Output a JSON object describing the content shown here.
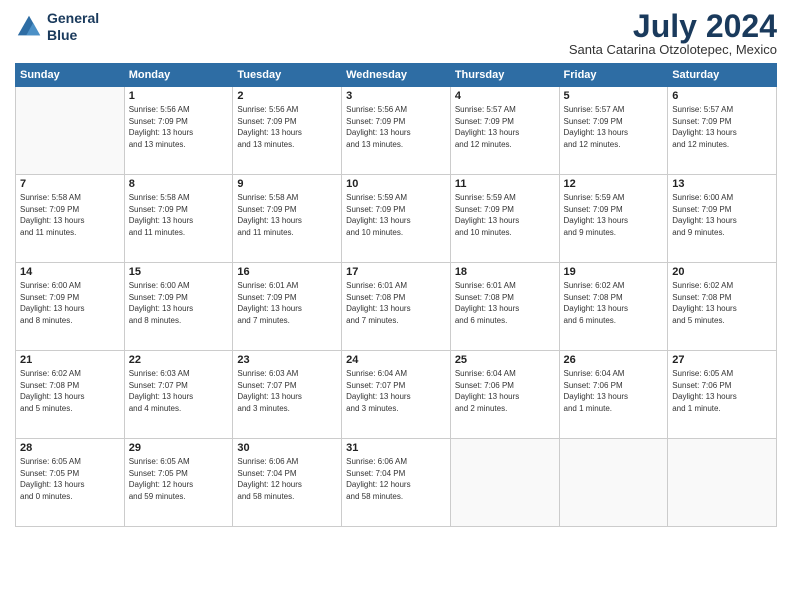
{
  "logo": {
    "line1": "General",
    "line2": "Blue"
  },
  "title": "July 2024",
  "subtitle": "Santa Catarina Otzolotepec, Mexico",
  "days_header": [
    "Sunday",
    "Monday",
    "Tuesday",
    "Wednesday",
    "Thursday",
    "Friday",
    "Saturday"
  ],
  "weeks": [
    [
      {
        "day": "",
        "info": ""
      },
      {
        "day": "1",
        "info": "Sunrise: 5:56 AM\nSunset: 7:09 PM\nDaylight: 13 hours\nand 13 minutes."
      },
      {
        "day": "2",
        "info": "Sunrise: 5:56 AM\nSunset: 7:09 PM\nDaylight: 13 hours\nand 13 minutes."
      },
      {
        "day": "3",
        "info": "Sunrise: 5:56 AM\nSunset: 7:09 PM\nDaylight: 13 hours\nand 13 minutes."
      },
      {
        "day": "4",
        "info": "Sunrise: 5:57 AM\nSunset: 7:09 PM\nDaylight: 13 hours\nand 12 minutes."
      },
      {
        "day": "5",
        "info": "Sunrise: 5:57 AM\nSunset: 7:09 PM\nDaylight: 13 hours\nand 12 minutes."
      },
      {
        "day": "6",
        "info": "Sunrise: 5:57 AM\nSunset: 7:09 PM\nDaylight: 13 hours\nand 12 minutes."
      }
    ],
    [
      {
        "day": "7",
        "info": "Sunrise: 5:58 AM\nSunset: 7:09 PM\nDaylight: 13 hours\nand 11 minutes."
      },
      {
        "day": "8",
        "info": "Sunrise: 5:58 AM\nSunset: 7:09 PM\nDaylight: 13 hours\nand 11 minutes."
      },
      {
        "day": "9",
        "info": "Sunrise: 5:58 AM\nSunset: 7:09 PM\nDaylight: 13 hours\nand 11 minutes."
      },
      {
        "day": "10",
        "info": "Sunrise: 5:59 AM\nSunset: 7:09 PM\nDaylight: 13 hours\nand 10 minutes."
      },
      {
        "day": "11",
        "info": "Sunrise: 5:59 AM\nSunset: 7:09 PM\nDaylight: 13 hours\nand 10 minutes."
      },
      {
        "day": "12",
        "info": "Sunrise: 5:59 AM\nSunset: 7:09 PM\nDaylight: 13 hours\nand 9 minutes."
      },
      {
        "day": "13",
        "info": "Sunrise: 6:00 AM\nSunset: 7:09 PM\nDaylight: 13 hours\nand 9 minutes."
      }
    ],
    [
      {
        "day": "14",
        "info": "Sunrise: 6:00 AM\nSunset: 7:09 PM\nDaylight: 13 hours\nand 8 minutes."
      },
      {
        "day": "15",
        "info": "Sunrise: 6:00 AM\nSunset: 7:09 PM\nDaylight: 13 hours\nand 8 minutes."
      },
      {
        "day": "16",
        "info": "Sunrise: 6:01 AM\nSunset: 7:09 PM\nDaylight: 13 hours\nand 7 minutes."
      },
      {
        "day": "17",
        "info": "Sunrise: 6:01 AM\nSunset: 7:08 PM\nDaylight: 13 hours\nand 7 minutes."
      },
      {
        "day": "18",
        "info": "Sunrise: 6:01 AM\nSunset: 7:08 PM\nDaylight: 13 hours\nand 6 minutes."
      },
      {
        "day": "19",
        "info": "Sunrise: 6:02 AM\nSunset: 7:08 PM\nDaylight: 13 hours\nand 6 minutes."
      },
      {
        "day": "20",
        "info": "Sunrise: 6:02 AM\nSunset: 7:08 PM\nDaylight: 13 hours\nand 5 minutes."
      }
    ],
    [
      {
        "day": "21",
        "info": "Sunrise: 6:02 AM\nSunset: 7:08 PM\nDaylight: 13 hours\nand 5 minutes."
      },
      {
        "day": "22",
        "info": "Sunrise: 6:03 AM\nSunset: 7:07 PM\nDaylight: 13 hours\nand 4 minutes."
      },
      {
        "day": "23",
        "info": "Sunrise: 6:03 AM\nSunset: 7:07 PM\nDaylight: 13 hours\nand 3 minutes."
      },
      {
        "day": "24",
        "info": "Sunrise: 6:04 AM\nSunset: 7:07 PM\nDaylight: 13 hours\nand 3 minutes."
      },
      {
        "day": "25",
        "info": "Sunrise: 6:04 AM\nSunset: 7:06 PM\nDaylight: 13 hours\nand 2 minutes."
      },
      {
        "day": "26",
        "info": "Sunrise: 6:04 AM\nSunset: 7:06 PM\nDaylight: 13 hours\nand 1 minute."
      },
      {
        "day": "27",
        "info": "Sunrise: 6:05 AM\nSunset: 7:06 PM\nDaylight: 13 hours\nand 1 minute."
      }
    ],
    [
      {
        "day": "28",
        "info": "Sunrise: 6:05 AM\nSunset: 7:05 PM\nDaylight: 13 hours\nand 0 minutes."
      },
      {
        "day": "29",
        "info": "Sunrise: 6:05 AM\nSunset: 7:05 PM\nDaylight: 12 hours\nand 59 minutes."
      },
      {
        "day": "30",
        "info": "Sunrise: 6:06 AM\nSunset: 7:04 PM\nDaylight: 12 hours\nand 58 minutes."
      },
      {
        "day": "31",
        "info": "Sunrise: 6:06 AM\nSunset: 7:04 PM\nDaylight: 12 hours\nand 58 minutes."
      },
      {
        "day": "",
        "info": ""
      },
      {
        "day": "",
        "info": ""
      },
      {
        "day": "",
        "info": ""
      }
    ]
  ]
}
